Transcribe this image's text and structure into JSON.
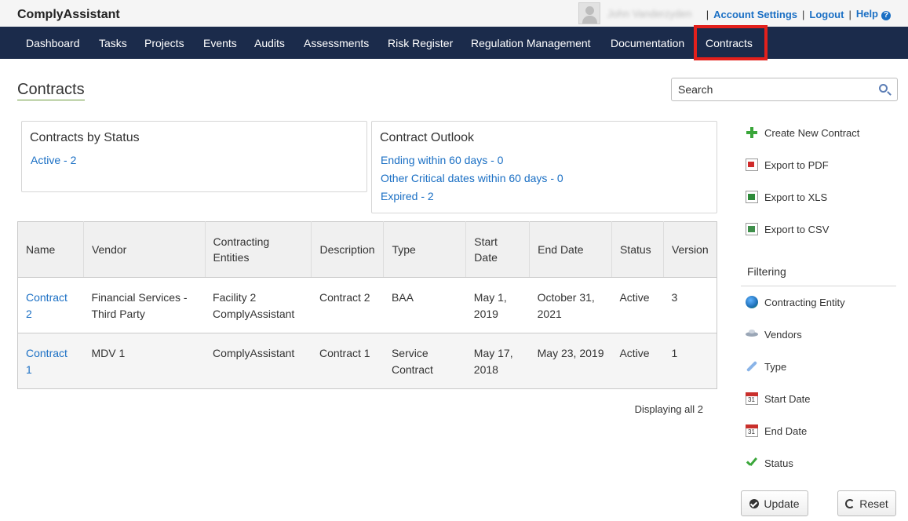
{
  "app": {
    "brand": "ComplyAssistant",
    "username": "John Vanderzyden",
    "links": {
      "account_settings": "Account Settings",
      "logout": "Logout",
      "help": "Help",
      "sep": "|"
    }
  },
  "nav": {
    "items": [
      "Dashboard",
      "Tasks",
      "Projects",
      "Events",
      "Audits",
      "Assessments",
      "Risk Register",
      "Regulation Management",
      "Documentation",
      "Contracts"
    ],
    "active": "Contracts"
  },
  "page": {
    "title": "Contracts",
    "search_placeholder": "Search"
  },
  "status_panel": {
    "title": "Contracts by Status",
    "links": [
      "Active - 2"
    ]
  },
  "outlook_panel": {
    "title": "Contract Outlook",
    "links": [
      "Ending within 60 days - 0",
      "Other Critical dates within 60 days - 0",
      "Expired - 2"
    ]
  },
  "table": {
    "headers": [
      "Name",
      "Vendor",
      "Contracting Entities",
      "Description",
      "Type",
      "Start Date",
      "End Date",
      "Status",
      "Version"
    ],
    "rows": [
      {
        "name": "Contract 2",
        "vendor": "Financial Services - Third Party",
        "entities": "Facility 2 ComplyAssistant",
        "description": "Contract 2",
        "type": "BAA",
        "start": "May 1, 2019",
        "end": "October 31, 2021",
        "status": "Active",
        "version": "3"
      },
      {
        "name": "Contract 1",
        "vendor": "MDV 1",
        "entities": "ComplyAssistant",
        "description": "Contract 1",
        "type": "Service Contract",
        "start": "May 17, 2018",
        "end": "May 23, 2019",
        "status": "Active",
        "version": "1"
      }
    ],
    "display_count": "Displaying all 2"
  },
  "actions": {
    "create": "Create New Contract",
    "pdf": "Export to PDF",
    "xls": "Export to XLS",
    "csv": "Export to CSV"
  },
  "filtering": {
    "heading": "Filtering",
    "items": [
      "Contracting Entity",
      "Vendors",
      "Type",
      "Start Date",
      "End Date",
      "Status"
    ],
    "update_label": "Update",
    "reset_label": "Reset"
  },
  "colors": {
    "nav_bg": "#1b2b4b",
    "link": "#1a6fc4",
    "active_highlight": "#e3201c"
  }
}
